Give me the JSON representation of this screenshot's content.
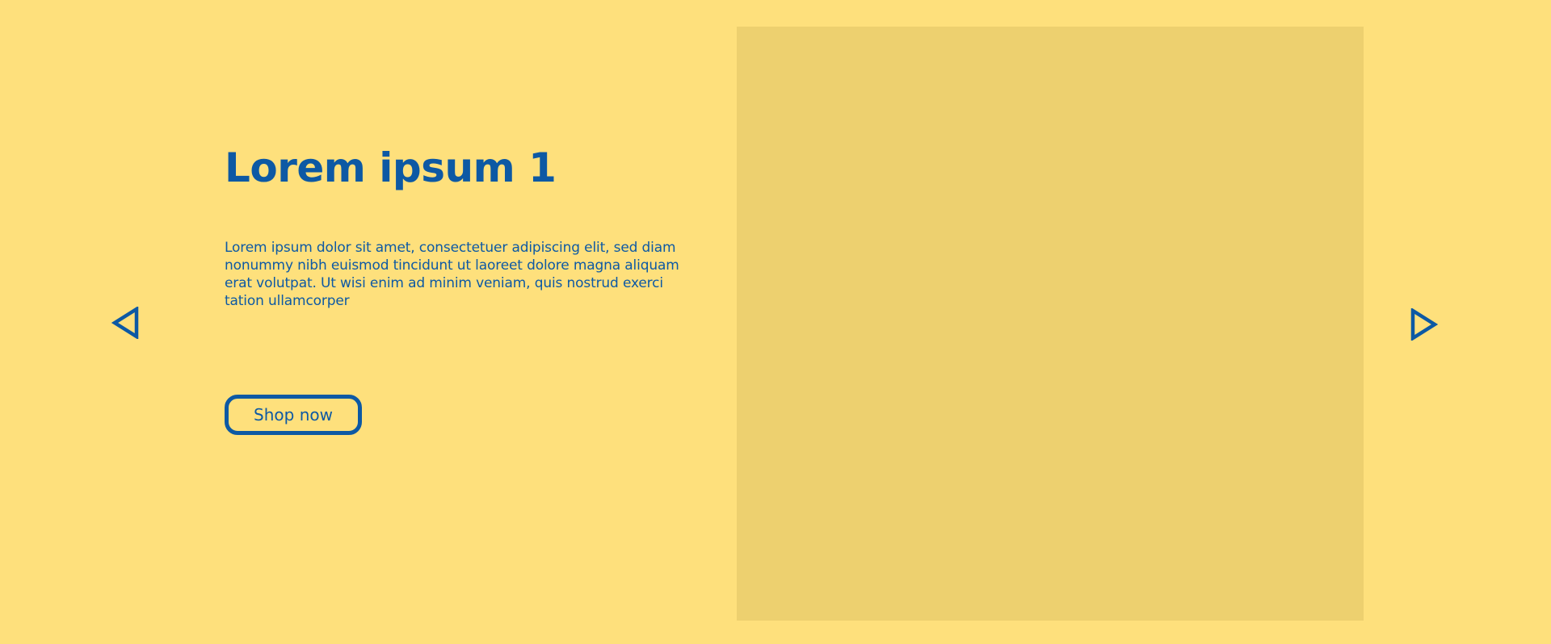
{
  "slide": {
    "title": "Lorem ipsum 1",
    "description": "Lorem ipsum dolor sit amet, consectetuer adipiscing elit, sed diam nonummy nibh euismod tincidunt ut laoreet dolore magna aliquam erat volutpat. Ut wisi enim ad minim veniam, quis nostrud exerci tation ullamcorper",
    "cta_label": "Shop now"
  },
  "navigation": {
    "prev_icon": "triangle-left-outline-icon",
    "next_icon": "triangle-right-outline-icon"
  },
  "colors": {
    "background": "#FEE07C",
    "image_placeholder": "#EDD06F",
    "accent": "#0D59A4"
  }
}
